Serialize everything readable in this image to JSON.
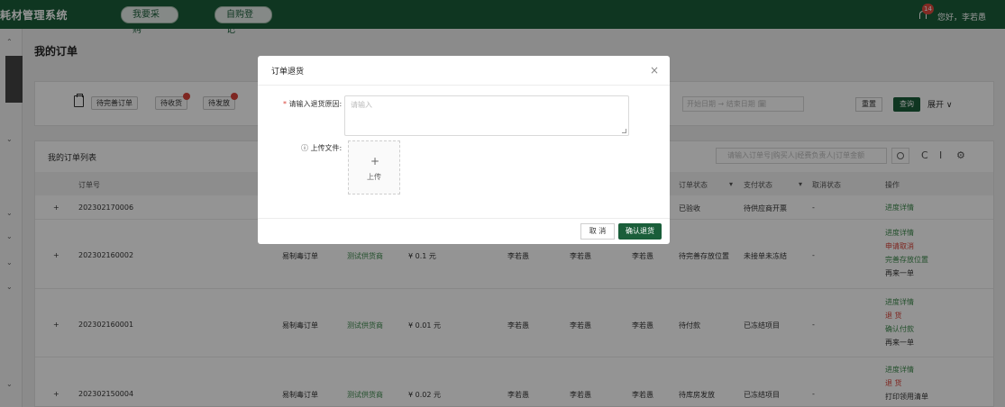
{
  "header": {
    "brand": "耗材管理系统",
    "nav": [
      "我要采购",
      "自购登记"
    ],
    "notification_count": "14",
    "greeting": "您好，李若愚"
  },
  "page": {
    "title": "我的订单"
  },
  "filters": {
    "chips": [
      "待完善订单",
      "待收货",
      "待发放"
    ],
    "date_range_placeholder": "开始日期   → 结束日期   🗓",
    "reset_label": "重置",
    "query_label": "查询",
    "expand_label": "展开 ∨"
  },
  "list": {
    "title": "我的订单列表",
    "search_placeholder": "请输入订单号|购买人|经费负责人|订单金额",
    "columns": [
      "订单号",
      "订单状态",
      "支付状态",
      "取消状态",
      "操作"
    ],
    "rows": [
      {
        "expand": "+",
        "order_no": "202302170006",
        "order_type": "",
        "supplier": "",
        "amount": "",
        "p1": "",
        "p2": "",
        "p3": "",
        "order_status": "已验收",
        "pay_status": "待供应商开票",
        "cancel_status": "-",
        "actions": [
          {
            "label": "进度详情",
            "color": "green"
          }
        ]
      },
      {
        "expand": "+",
        "order_no": "202302160002",
        "order_type": "易制毒订单",
        "supplier": "测试供货商",
        "amount": "¥ 0.1 元",
        "p1": "李若愚",
        "p2": "李若愚",
        "p3": "李若愚",
        "order_status": "待完善存放位置",
        "pay_status": "未接单未冻结",
        "cancel_status": "-",
        "actions": [
          {
            "label": "进度详情",
            "color": "green"
          },
          {
            "label": "申请取消",
            "color": "red"
          },
          {
            "label": "完善存放位置",
            "color": "green"
          },
          {
            "label": "再来一单",
            "color": "dark"
          }
        ]
      },
      {
        "expand": "+",
        "order_no": "202302160001",
        "order_type": "易制毒订单",
        "supplier": "测试供货商",
        "amount": "¥ 0.01 元",
        "p1": "李若愚",
        "p2": "李若愚",
        "p3": "李若愚",
        "order_status": "待付款",
        "pay_status": "已冻结项目",
        "cancel_status": "-",
        "actions": [
          {
            "label": "进度详情",
            "color": "green"
          },
          {
            "label": "退 货",
            "color": "red"
          },
          {
            "label": "确认付款",
            "color": "green"
          },
          {
            "label": "再来一单",
            "color": "dark"
          }
        ]
      },
      {
        "expand": "+",
        "order_no": "202302150004",
        "order_type": "易制毒订单",
        "supplier": "测试供货商",
        "amount": "¥ 0.02 元",
        "p1": "李若愚",
        "p2": "李若愚",
        "p3": "李若愚",
        "order_status": "待库房发放",
        "pay_status": "已冻结项目",
        "cancel_status": "-",
        "actions": [
          {
            "label": "进度详情",
            "color": "green"
          },
          {
            "label": "退 货",
            "color": "red"
          },
          {
            "label": "打印领用清单",
            "color": "dark"
          }
        ]
      }
    ]
  },
  "modal": {
    "title": "订单退货",
    "close": "×",
    "reason_label": "请输入退货原因:",
    "required_mark": "*",
    "reason_placeholder": "请输入",
    "upload_label": "ⓘ 上传文件:",
    "upload_plus": "+",
    "upload_text": "上传",
    "cancel_label": "取 消",
    "confirm_label": "确认退货"
  },
  "colors": {
    "brand_green": "#1a5e3a",
    "action_green": "#3d8a4d",
    "action_red": "#d9433a"
  }
}
